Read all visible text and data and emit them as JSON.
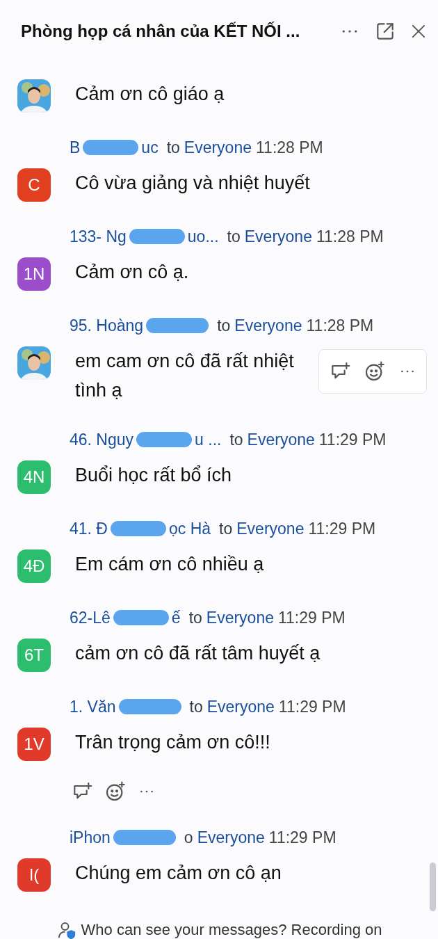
{
  "window": {
    "title": "Phòng họp cá nhân của KẾT NỐI ..."
  },
  "messages": [
    {
      "avatar": {
        "kind": "picture"
      },
      "text": "Cảm ơn cô giáo ạ"
    },
    {
      "sender": [
        "B",
        "uc"
      ],
      "recipient_prefix": "to",
      "recipient": "Everyone",
      "time": "11:28 PM",
      "avatar": {
        "kind": "initials",
        "initials": "C",
        "color": "#e0401f"
      },
      "text": "Cô vừa giảng và nhiệt huyết"
    },
    {
      "sender": [
        "133- Ng",
        "uo..."
      ],
      "recipient_prefix": "to",
      "recipient": "Everyone",
      "time": "11:28 PM",
      "avatar": {
        "kind": "initials",
        "initials": "1N",
        "color": "#9b4dca"
      },
      "text": "Cảm ơn cô ạ."
    },
    {
      "sender": [
        "95. Hoàng"
      ],
      "recipient_prefix": "to",
      "recipient": "Everyone",
      "time": "11:28 PM",
      "avatar": {
        "kind": "picture"
      },
      "text": "em cam ơn cô đã rất nhiệt tình ạ",
      "action_bar": {
        "kind": "floating"
      }
    },
    {
      "sender": [
        "46. Nguy",
        "u ..."
      ],
      "recipient_prefix": "to",
      "recipient": "Everyone",
      "time": "11:29 PM",
      "avatar": {
        "kind": "initials",
        "initials": "4N",
        "color": "#2dbd6e"
      },
      "text": "Buổi học rất bổ ích"
    },
    {
      "sender": [
        "41. Đ",
        "ọc Hà"
      ],
      "recipient_prefix": "to",
      "recipient": "Everyone",
      "time": "11:29 PM",
      "avatar": {
        "kind": "initials",
        "initials": "4Đ",
        "color": "#2dbd6e"
      },
      "text": "Em cám ơn cô nhiều ạ"
    },
    {
      "sender": [
        "62-Lê",
        "ế"
      ],
      "recipient_prefix": "to",
      "recipient": "Everyone",
      "time": "11:29 PM",
      "avatar": {
        "kind": "initials",
        "initials": "6T",
        "color": "#2dbd6e"
      },
      "text": "cảm ơn cô đã rất tâm huyết ạ"
    },
    {
      "sender": [
        "1. Văn"
      ],
      "recipient_prefix": "to",
      "recipient": "Everyone",
      "time": "11:29 PM",
      "avatar": {
        "kind": "initials",
        "initials": "1V",
        "color": "#e03a2a"
      },
      "text": "Trân trọng cảm ơn cô!!!",
      "action_bar": {
        "kind": "inline"
      }
    },
    {
      "sender": [
        "iPhon"
      ],
      "recipient_prefix": "o",
      "recipient": "Everyone",
      "time": "11:29 PM",
      "avatar": {
        "kind": "initials",
        "initials": "I(",
        "color": "#e03a2a"
      },
      "text": "Chúng em cảm ơn cô ạn"
    }
  ],
  "footer": {
    "text": "Who can see your messages? Recording on"
  }
}
